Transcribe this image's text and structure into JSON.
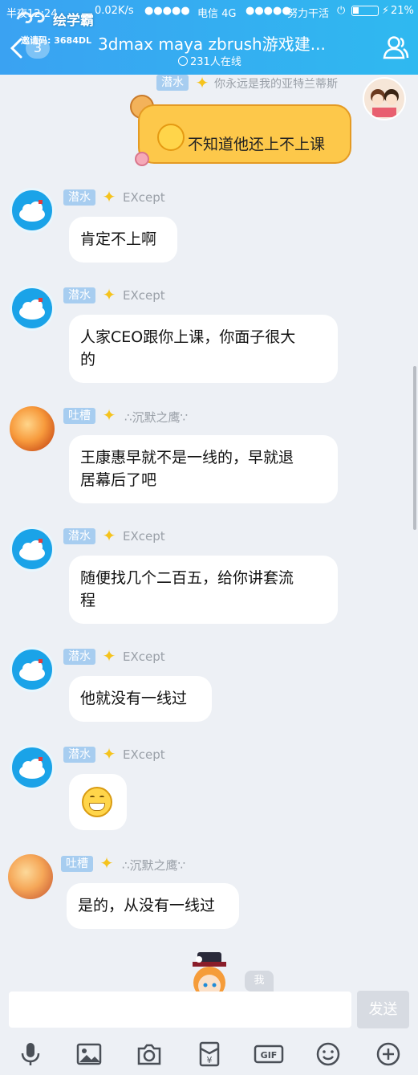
{
  "status_bar": {
    "time": "半夜12:24",
    "speed": "0.02K/s",
    "carrier": "电信 4G",
    "carrier2": "努力干活",
    "battery": "21%"
  },
  "watermark": {
    "text": "绘学霸",
    "invite": "邀请码: 3684DL"
  },
  "header": {
    "back_count": "3",
    "title": "3dmax maya zbrush游戏建...",
    "online": "231人在线"
  },
  "top_message": {
    "tag": "潜水",
    "nick": "你永远是我的亚特兰蒂斯",
    "text": "不知道他还上不上课"
  },
  "messages": [
    {
      "tag": "潜水",
      "nick": "EXcept",
      "lines": [
        "肯定不上啊"
      ]
    },
    {
      "tag": "潜水",
      "nick": "EXcept",
      "lines": [
        "人家CEO跟你上课，你面子很大",
        "的"
      ]
    },
    {
      "tag": "吐槽",
      "nick": "∴沉默之鹰∵",
      "lines": [
        "王康惠早就不是一线的，早就退",
        "居幕后了吧"
      ]
    },
    {
      "tag": "潜水",
      "nick": "EXcept",
      "lines": [
        "随便找几个二百五，给你讲套流",
        "程"
      ]
    },
    {
      "tag": "潜水",
      "nick": "EXcept",
      "lines": [
        "他就没有一线过"
      ]
    },
    {
      "tag": "潜水",
      "nick": "EXcept",
      "lines": [
        ""
      ]
    },
    {
      "tag": "吐槽",
      "nick": "∴沉默之鹰∵",
      "lines": [
        "是的，从没有一线过"
      ]
    }
  ],
  "me_label": "我",
  "input": {
    "send_label": "发送"
  },
  "toolbar_icons": [
    "microphone-icon",
    "image-icon",
    "camera-icon",
    "red-packet-icon",
    "gif-icon",
    "emoji-icon",
    "plus-icon"
  ],
  "colors": {
    "header": "#3aa2f2",
    "self_bubble": "#fdc84a",
    "tag": "#a7cdf0",
    "background": "#edf0f5"
  }
}
